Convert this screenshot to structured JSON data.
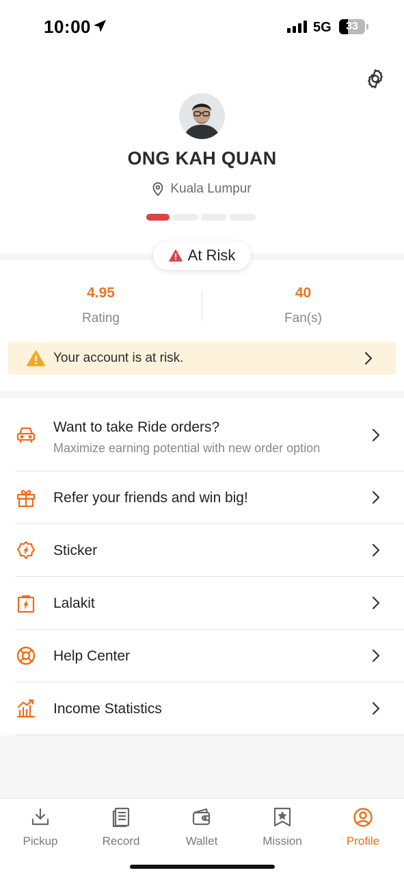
{
  "status_bar": {
    "time": "10:00",
    "network": "5G",
    "battery": "33"
  },
  "profile": {
    "name": "ONG KAH QUAN",
    "location": "Kuala Lumpur",
    "level_filled": 1,
    "level_total": 4
  },
  "risk_badge": {
    "label": "At Risk"
  },
  "stats": {
    "rating": {
      "value": "4.95",
      "label": "Rating"
    },
    "fans": {
      "value": "40",
      "label": "Fan(s)"
    }
  },
  "alert": {
    "text": "Your account is at risk."
  },
  "menu": {
    "items": [
      {
        "title": "Want to take Ride orders?",
        "subtitle": "Maximize earning potential with new order option",
        "icon": "car-icon"
      },
      {
        "title": "Refer your friends and win big!",
        "icon": "gift-icon"
      },
      {
        "title": "Sticker",
        "icon": "sticker-icon"
      },
      {
        "title": "Lalakit",
        "icon": "kit-icon"
      },
      {
        "title": "Help Center",
        "icon": "lifebuoy-icon"
      },
      {
        "title": "Income Statistics",
        "icon": "chart-icon"
      }
    ]
  },
  "tabbar": {
    "tabs": [
      {
        "label": "Pickup",
        "icon": "download-icon"
      },
      {
        "label": "Record",
        "icon": "record-icon"
      },
      {
        "label": "Wallet",
        "icon": "wallet-icon"
      },
      {
        "label": "Mission",
        "icon": "mission-icon"
      },
      {
        "label": "Profile",
        "icon": "profile-icon"
      }
    ],
    "active": "Profile"
  },
  "colors": {
    "accent": "#f06b16",
    "risk_red": "#d94545",
    "alert_bg": "#fdf3dc",
    "warning": "#f5a623"
  }
}
